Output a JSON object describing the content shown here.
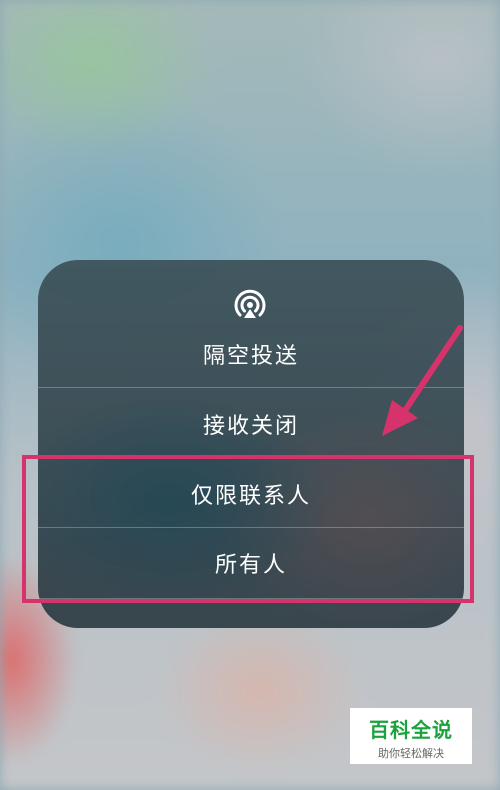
{
  "airdrop_menu": {
    "title": "隔空投送",
    "icon": "airdrop-icon",
    "options": [
      {
        "label": "接收关闭"
      },
      {
        "label": "仅限联系人"
      },
      {
        "label": "所有人"
      }
    ]
  },
  "annotation": {
    "highlight_color": "#d6336c"
  },
  "watermark": {
    "title": "百科全说",
    "subtitle": "助你轻松解决"
  }
}
